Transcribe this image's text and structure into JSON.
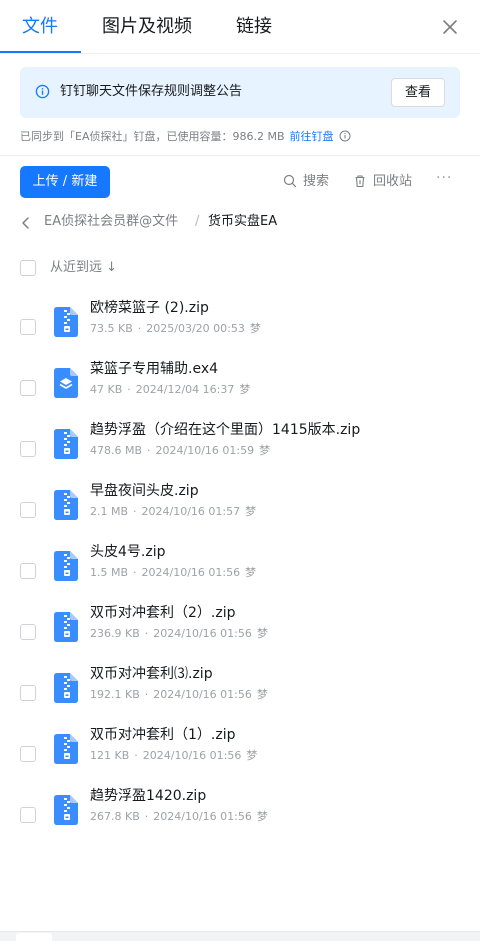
{
  "tabs": [
    {
      "label": "文件",
      "active": true
    },
    {
      "label": "图片及视频",
      "active": false
    },
    {
      "label": "链接",
      "active": false
    }
  ],
  "notice": {
    "text": "钉钉聊天文件保存规则调整公告",
    "button": "查看"
  },
  "sync": {
    "text": "已同步到「EA侦探社」钉盘，已使用容量：986.2 MB",
    "link": "前往钉盘"
  },
  "toolbar": {
    "upload": "上传 / 新建",
    "search": "搜索",
    "recycle": "回收站",
    "more": "···"
  },
  "breadcrumb": {
    "parent": "EA侦探社会员群@文件",
    "separator": "/",
    "current": "货币实盘EA"
  },
  "sort": {
    "label": "从近到远 ↓"
  },
  "files": [
    {
      "name": "欧榜菜篮子 (2).zip",
      "size": "73.5 KB",
      "date": "2025/03/20 00:53",
      "owner": "梦",
      "icon": "zip-icon"
    },
    {
      "name": "菜篮子专用辅助.ex4",
      "size": "47 KB",
      "date": "2024/12/04 16:37",
      "owner": "梦",
      "icon": "ex4-icon"
    },
    {
      "name": "趋势浮盈（介绍在这个里面）1415版本.zip",
      "size": "478.6 MB",
      "date": "2024/10/16 01:59",
      "owner": "梦",
      "icon": "zip-icon"
    },
    {
      "name": "早盘夜间头皮.zip",
      "size": "2.1 MB",
      "date": "2024/10/16 01:57",
      "owner": "梦",
      "icon": "zip-icon"
    },
    {
      "name": "头皮4号.zip",
      "size": "1.5 MB",
      "date": "2024/10/16 01:56",
      "owner": "梦",
      "icon": "zip-icon"
    },
    {
      "name": "双币对冲套利（2）.zip",
      "size": "236.9 KB",
      "date": "2024/10/16 01:56",
      "owner": "梦",
      "icon": "zip-icon"
    },
    {
      "name": "双币对冲套利⑶.zip",
      "size": "192.1 KB",
      "date": "2024/10/16 01:56",
      "owner": "梦",
      "icon": "zip-icon"
    },
    {
      "name": "双币对冲套利（1）.zip",
      "size": "121 KB",
      "date": "2024/10/16 01:56",
      "owner": "梦",
      "icon": "zip-icon"
    },
    {
      "name": "趋势浮盈1420.zip",
      "size": "267.8 KB",
      "date": "2024/10/16 01:56",
      "owner": "梦",
      "icon": "zip-icon"
    }
  ],
  "colors": {
    "accent": "#1677ff",
    "notice_bg": "#e7f3ff",
    "file_icon": "#3a8dff"
  }
}
